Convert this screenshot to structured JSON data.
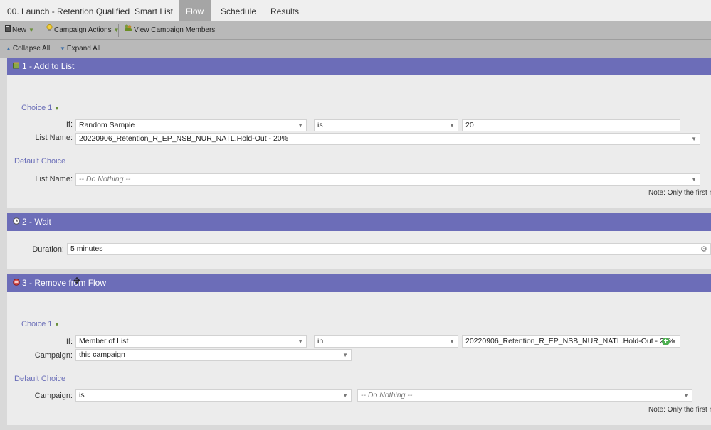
{
  "tabs": [
    {
      "label": "00. Launch - Retention Qualified"
    },
    {
      "label": "Smart List"
    },
    {
      "label": "Flow"
    },
    {
      "label": "Schedule"
    },
    {
      "label": "Results"
    }
  ],
  "toolbar": {
    "new_label": "New",
    "campaign_actions_label": "Campaign Actions",
    "view_members_label": "View Campaign Members",
    "collapse_all_label": "Collapse All",
    "expand_all_label": "Expand All"
  },
  "steps": [
    {
      "title": "1 - Add to List",
      "choice_label": "Choice 1",
      "if_label": "If:",
      "if_field": "Random Sample",
      "if_operator": "is",
      "if_value": "20",
      "list_name_label": "List Name:",
      "list_name_value": "20220906_Retention_R_EP_NSB_NUR_NATL.Hold-Out  - 20%",
      "default_choice_label": "Default Choice",
      "default_list_name_label": "List Name:",
      "default_list_name_value": "-- Do Nothing --",
      "note": "Note: Only the first ma"
    },
    {
      "title": "2 - Wait",
      "duration_label": "Duration:",
      "duration_value": "5 minutes"
    },
    {
      "title": "3 - Remove from Flow",
      "choice_label": "Choice 1",
      "if_label": "If:",
      "if_field": "Member of List",
      "if_operator": "in",
      "if_value": "20220906_Retention_R_EP_NSB_NUR_NATL.Hold-Out  - 20%",
      "campaign_label": "Campaign:",
      "campaign_value": "this campaign",
      "default_choice_label": "Default Choice",
      "default_campaign_label": "Campaign:",
      "default_campaign_operator": "is",
      "default_campaign_value": "-- Do Nothing --",
      "note": "Note: Only the first ma"
    }
  ],
  "icons": {
    "new": "new-icon",
    "campaign_actions": "lightbulb-icon",
    "view_members": "members-icon",
    "collapse": "collapse-icon",
    "expand": "expand-icon",
    "step1": "add-to-list-icon",
    "step2": "wait-clock-icon",
    "step3": "remove-from-flow-icon"
  },
  "colors": {
    "step_header": "#6c6db8",
    "active_tab": "#a5a5a5",
    "choice_label": "#6a6eb8"
  }
}
